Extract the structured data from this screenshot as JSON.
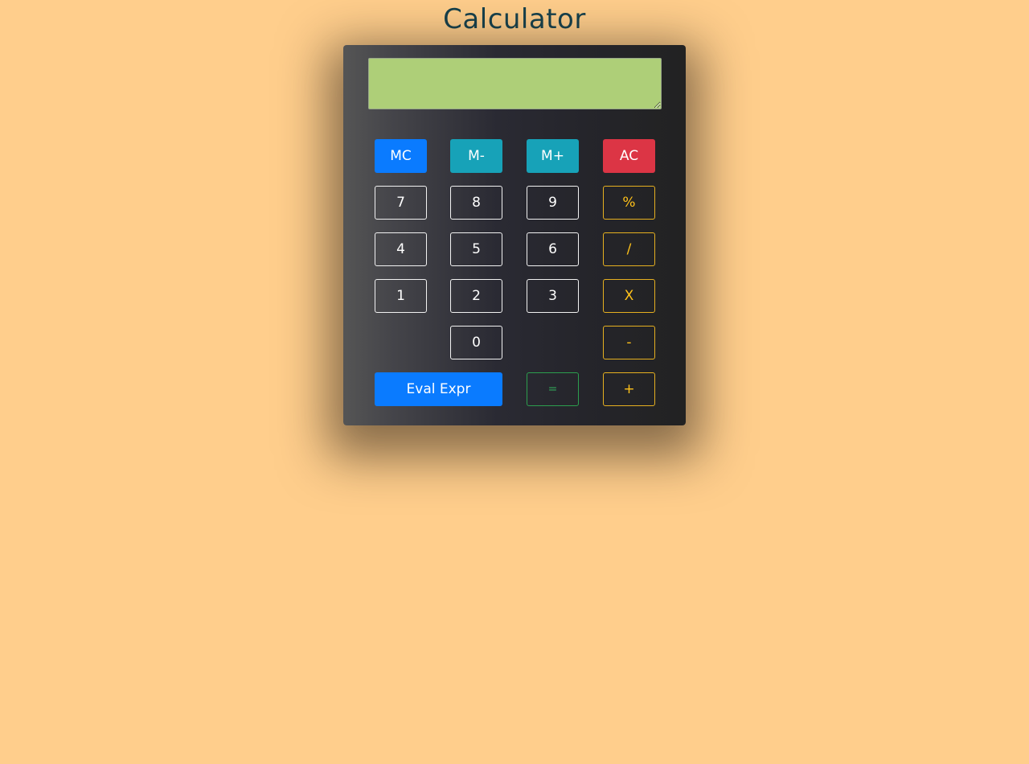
{
  "page": {
    "title": "Calculator"
  },
  "display": {
    "value": ""
  },
  "colors": {
    "background": "#ffce8c",
    "title": "#16414c",
    "display": "#aecf78",
    "primary": "#0a7bff",
    "info": "#17a2b8",
    "danger": "#dc3545",
    "warning": "#ffc21a",
    "success": "#31a95a"
  },
  "keys": {
    "mc": "MC",
    "m_minus": "M-",
    "m_plus": "M+",
    "ac": "AC",
    "seven": "7",
    "eight": "8",
    "nine": "9",
    "percent": "%",
    "four": "4",
    "five": "5",
    "six": "6",
    "divide": "/",
    "one": "1",
    "two": "2",
    "three": "3",
    "multiply": "X",
    "zero": "0",
    "minus": "-",
    "eval_expr": "Eval Expr",
    "equals": "=",
    "plus": "+"
  }
}
